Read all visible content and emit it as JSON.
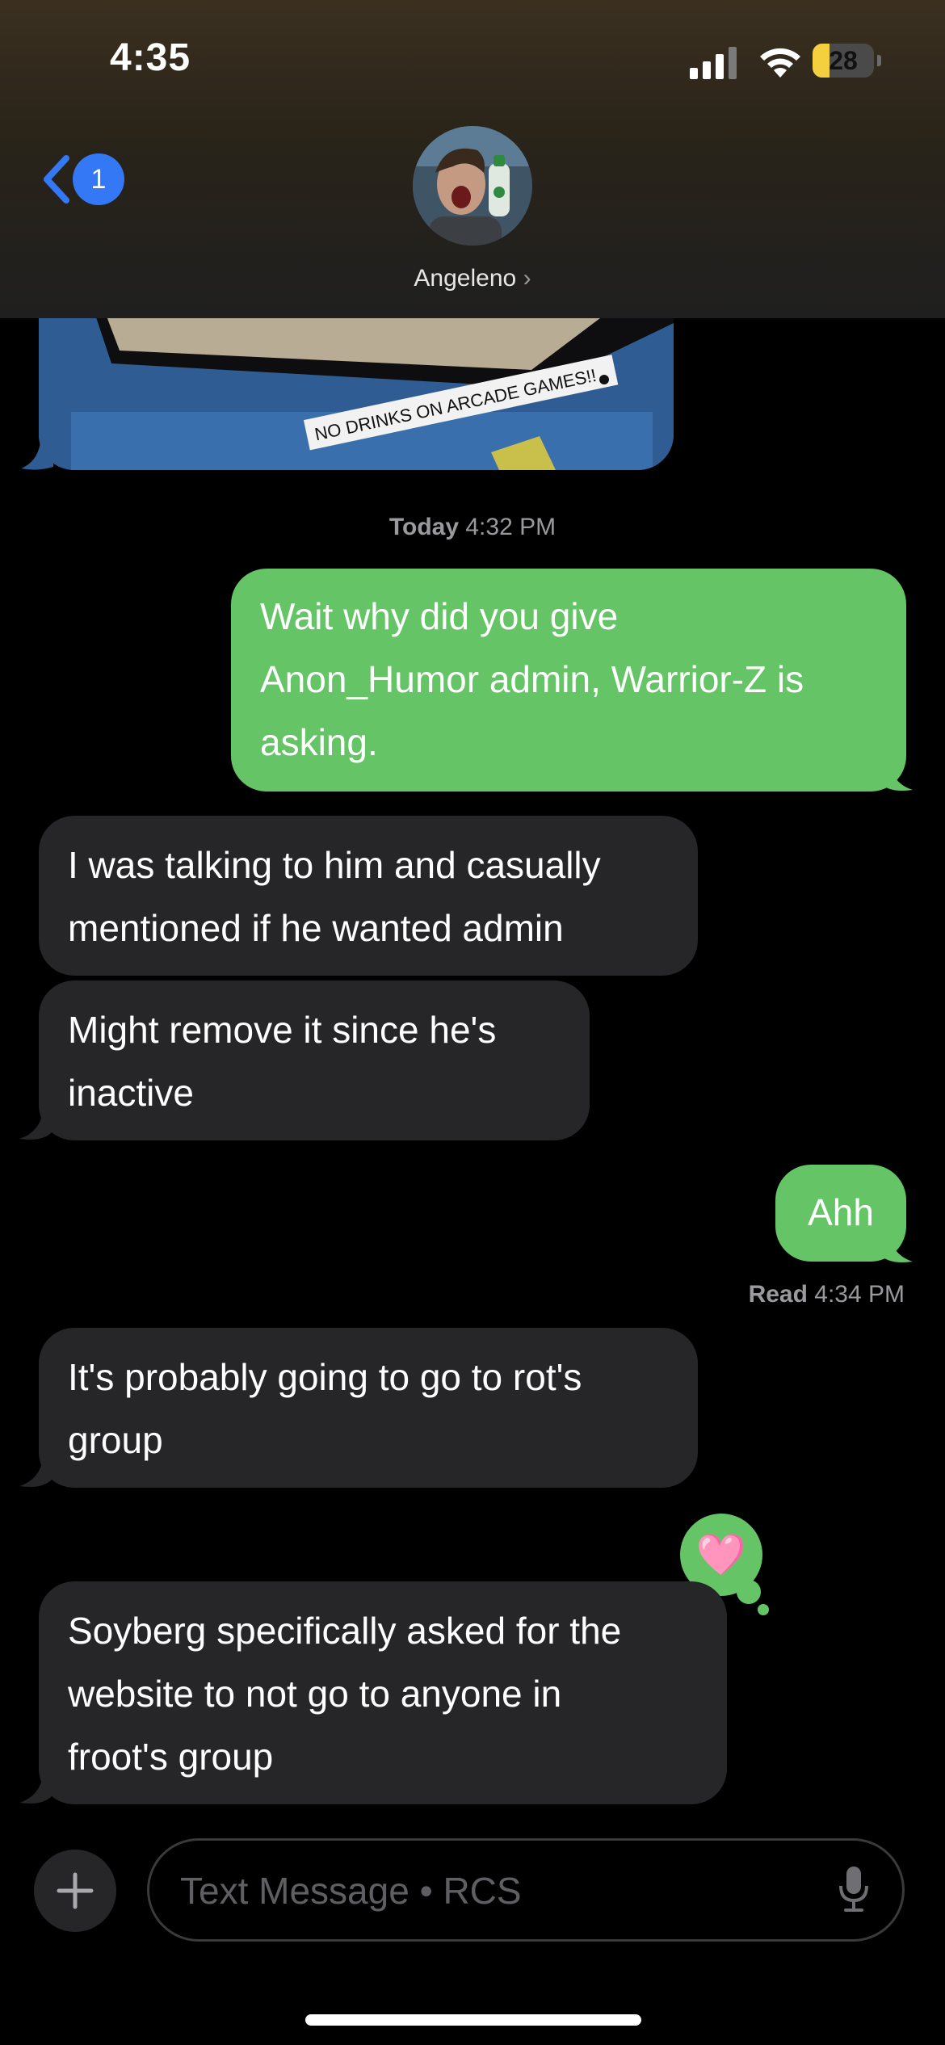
{
  "status_bar": {
    "time": "4:35",
    "battery": "28"
  },
  "header": {
    "back_badge": "1",
    "contact_name": "Angeleno",
    "contact_chevron": "›"
  },
  "photo": {
    "sign_text": "NO DRINKS ON ARCADE GAMES!!"
  },
  "timestamp": {
    "day": "Today",
    "time": "4:32 PM"
  },
  "messages": [
    {
      "direction": "out",
      "text": "Wait why did you give\nAnon_Humor admin, Warrior-Z is\nasking."
    },
    {
      "direction": "in",
      "text": "I was talking to him and casually\nmentioned if he wanted admin"
    },
    {
      "direction": "in",
      "text": "Might remove it since he's\ninactive"
    },
    {
      "direction": "out",
      "text": "Ahh"
    },
    {
      "direction": "in",
      "text": "It's probably going to go to rot's\ngroup"
    },
    {
      "direction": "in",
      "text": "Soyberg specifically asked for the\nwebsite to not go to anyone in\nfroot's group",
      "reaction": "🩷"
    }
  ],
  "read_receipt": {
    "label": "Read",
    "time": "4:34 PM"
  },
  "composer": {
    "placeholder": "Text Message • RCS"
  },
  "colors": {
    "outgoing": "#65c466",
    "incoming": "#262628",
    "badge": "#3478f6"
  }
}
